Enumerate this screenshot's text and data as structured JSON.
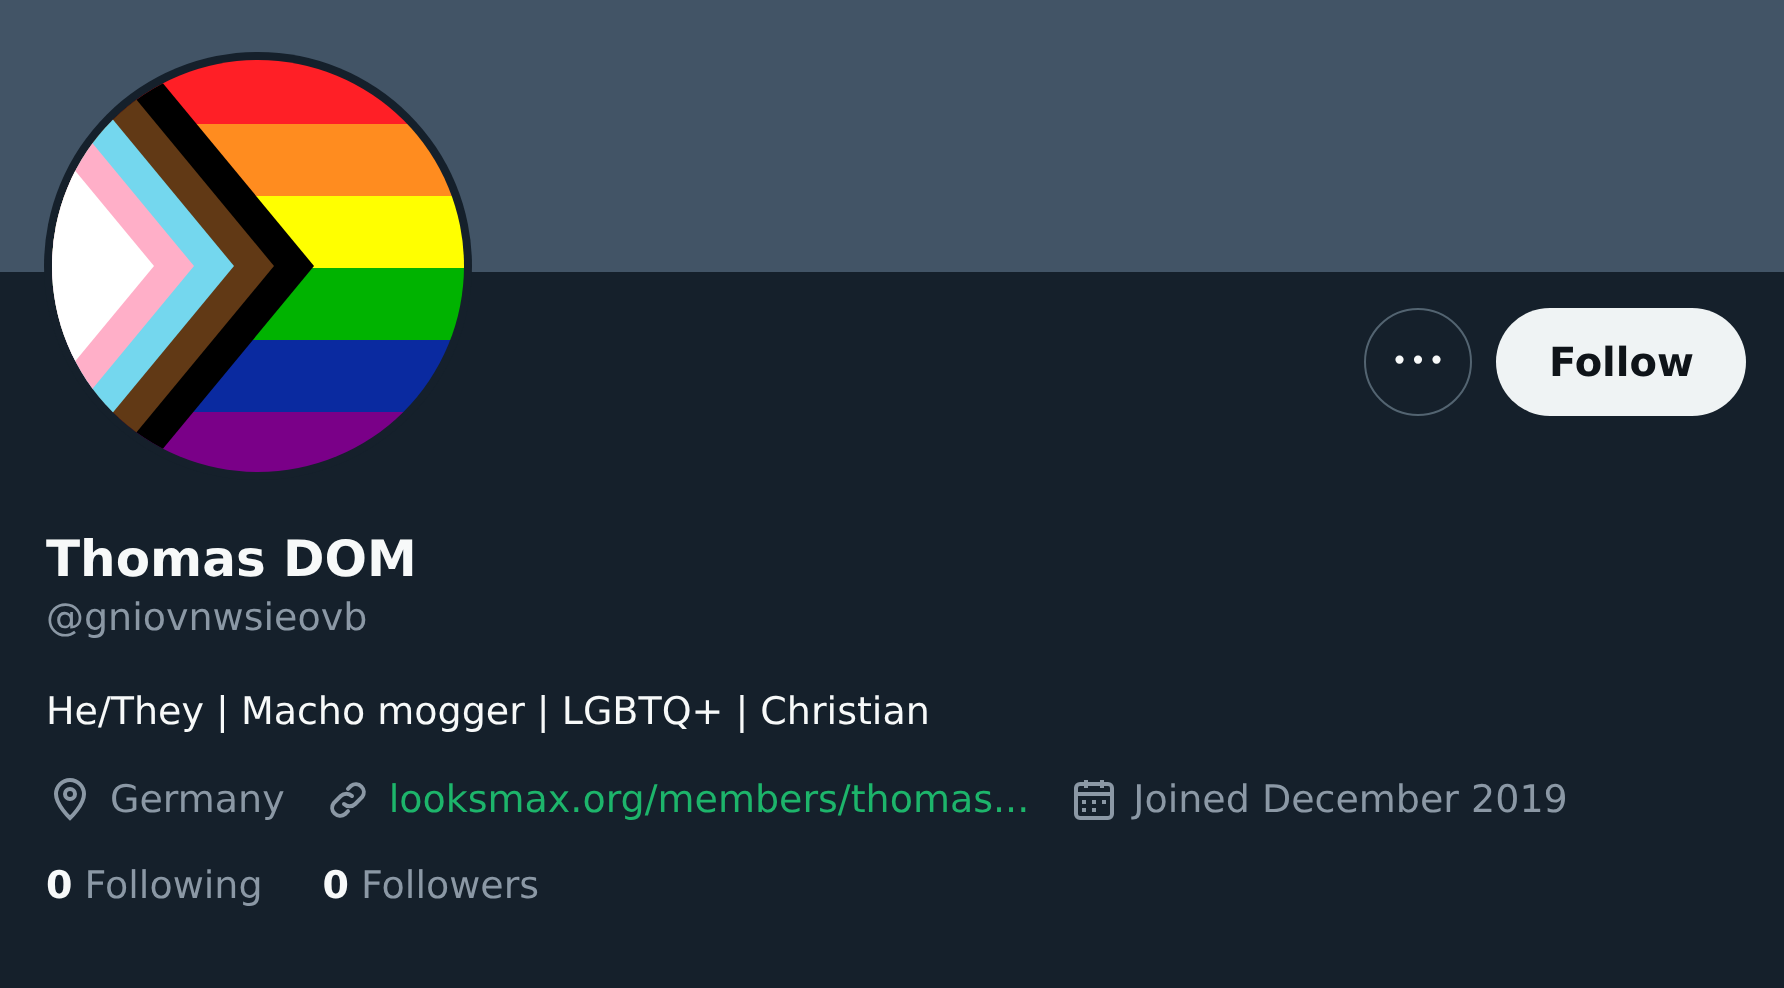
{
  "header": {
    "kind": "banner"
  },
  "avatar": {
    "kind": "flag"
  },
  "actions": {
    "more": "•••",
    "follow": "Follow"
  },
  "profile": {
    "name": "Thomas DOM",
    "handle": "@gniovnwsieovb",
    "bio": "He/They | Macho mogger | LGBTQ+ | Christian"
  },
  "meta": [
    {
      "kind": "location",
      "text": "Germany"
    },
    {
      "kind": "link",
      "text": "looksmax.org/members/thomas..."
    },
    {
      "kind": "joined",
      "text": "Joined December 2019"
    }
  ],
  "stats": [
    {
      "count": "0",
      "label": "Following"
    },
    {
      "count": "0",
      "label": "Followers"
    }
  ]
}
